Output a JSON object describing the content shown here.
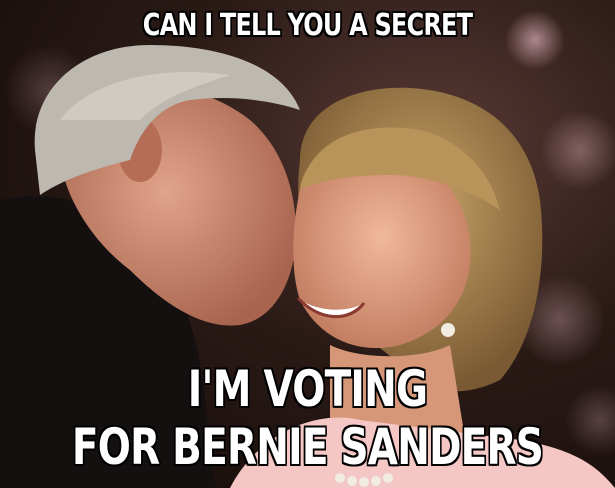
{
  "meme": {
    "top_text": "CAN I TELL YOU A SECRET",
    "bottom_line1": "I'M VOTING",
    "bottom_line2": "FOR BERNIE SANDERS"
  },
  "colors": {
    "caption": "#ffffff",
    "caption_outline": "#000000",
    "background": "#2a1a16"
  }
}
